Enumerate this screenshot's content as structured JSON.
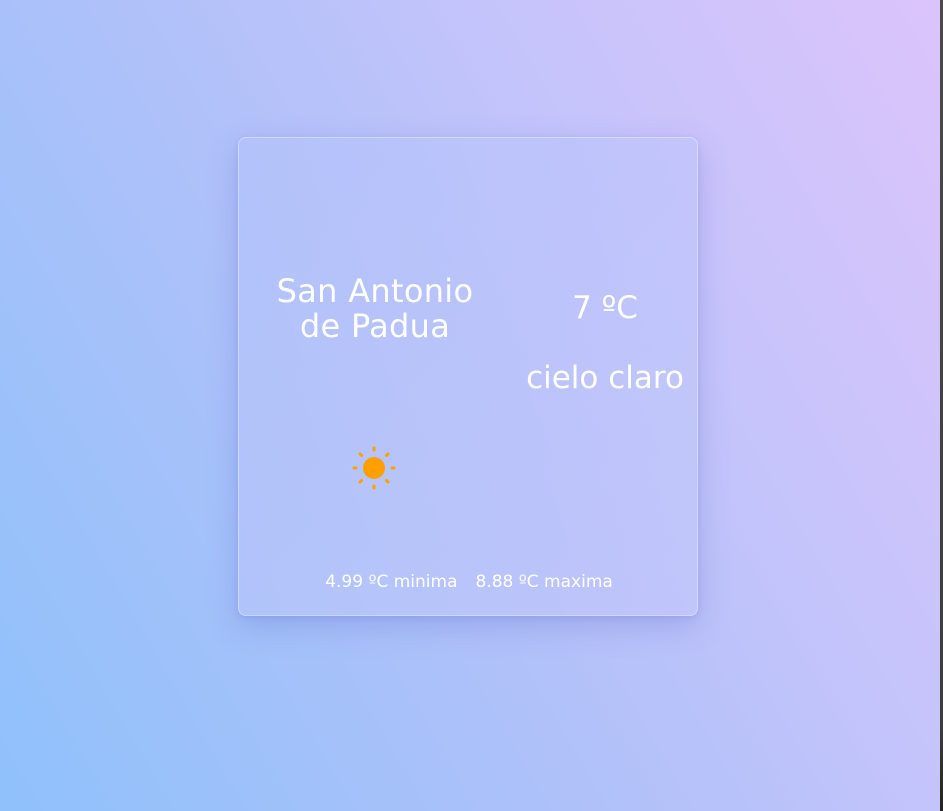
{
  "weather": {
    "city_line1": "San Antonio",
    "city_line2": "de Padua",
    "temperature": "7 ºC",
    "description": "cielo claro",
    "icon": "sun-icon",
    "min_text": "4.99 ºC minima",
    "max_text": "8.88 ºC maxima"
  },
  "colors": {
    "sun": "#FFA000",
    "text": "#FFFFFF"
  }
}
